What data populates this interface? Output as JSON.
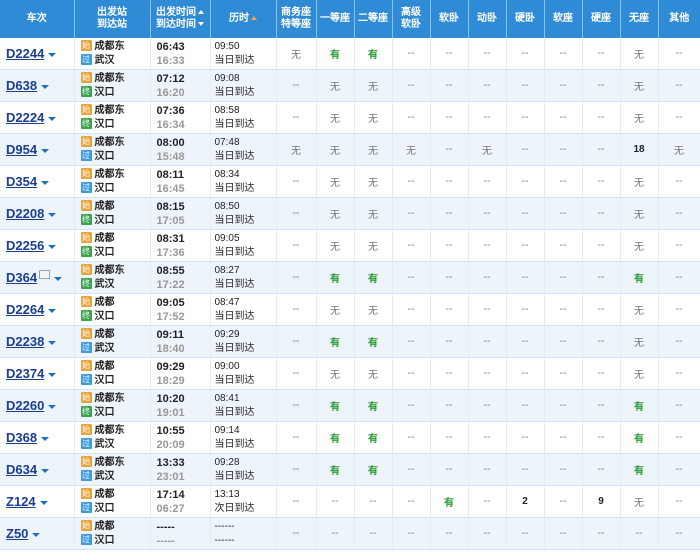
{
  "headers": {
    "train": "车次",
    "station_top": "出发站",
    "station_bottom": "到达站",
    "time_top": "出发时间",
    "time_bottom": "到达时间",
    "duration": "历时",
    "business_top": "商务座",
    "business_bottom": "特等座",
    "first": "一等座",
    "second": "二等座",
    "adv_top": "高级",
    "adv_bottom": "软卧",
    "soft_sleeper": "软卧",
    "moving_sleeper": "动卧",
    "hard_sleeper": "硬卧",
    "soft_seat": "软座",
    "hard_seat": "硬座",
    "no_seat": "无座",
    "other": "其他"
  },
  "station_badges": {
    "start": "始",
    "pass": "过",
    "end": "终"
  },
  "rows": [
    {
      "train": "D2244",
      "id_icon": false,
      "from": "成都东",
      "from_type": "start",
      "to": "武汉",
      "to_type": "pass",
      "dep": "06:43",
      "arr": "16:33",
      "dur": "09:50",
      "day": "当日到达",
      "seats": [
        "无",
        "有",
        "有",
        "--",
        "--",
        "--",
        "--",
        "--",
        "--",
        "无",
        "--"
      ]
    },
    {
      "train": "D638",
      "id_icon": false,
      "from": "成都东",
      "from_type": "start",
      "to": "汉口",
      "to_type": "end",
      "dep": "07:12",
      "arr": "16:20",
      "dur": "09:08",
      "day": "当日到达",
      "seats": [
        "--",
        "无",
        "无",
        "--",
        "--",
        "--",
        "--",
        "--",
        "--",
        "无",
        "--"
      ]
    },
    {
      "train": "D2224",
      "id_icon": false,
      "from": "成都东",
      "from_type": "start",
      "to": "汉口",
      "to_type": "end",
      "dep": "07:36",
      "arr": "16:34",
      "dur": "08:58",
      "day": "当日到达",
      "seats": [
        "--",
        "无",
        "无",
        "--",
        "--",
        "--",
        "--",
        "--",
        "--",
        "无",
        "--"
      ]
    },
    {
      "train": "D954",
      "id_icon": false,
      "from": "成都东",
      "from_type": "start",
      "to": "汉口",
      "to_type": "pass",
      "dep": "08:00",
      "arr": "15:48",
      "dur": "07:48",
      "day": "当日到达",
      "seats": [
        "无",
        "无",
        "无",
        "无",
        "--",
        "无",
        "--",
        "--",
        "--",
        "18",
        "无"
      ]
    },
    {
      "train": "D354",
      "id_icon": false,
      "from": "成都东",
      "from_type": "start",
      "to": "汉口",
      "to_type": "pass",
      "dep": "08:11",
      "arr": "16:45",
      "dur": "08:34",
      "day": "当日到达",
      "seats": [
        "--",
        "无",
        "无",
        "--",
        "--",
        "--",
        "--",
        "--",
        "--",
        "无",
        "--"
      ]
    },
    {
      "train": "D2208",
      "id_icon": false,
      "from": "成都",
      "from_type": "start",
      "to": "汉口",
      "to_type": "end",
      "dep": "08:15",
      "arr": "17:05",
      "dur": "08:50",
      "day": "当日到达",
      "seats": [
        "--",
        "无",
        "无",
        "--",
        "--",
        "--",
        "--",
        "--",
        "--",
        "无",
        "--"
      ]
    },
    {
      "train": "D2256",
      "id_icon": false,
      "from": "成都",
      "from_type": "start",
      "to": "汉口",
      "to_type": "end",
      "dep": "08:31",
      "arr": "17:36",
      "dur": "09:05",
      "day": "当日到达",
      "seats": [
        "--",
        "无",
        "无",
        "--",
        "--",
        "--",
        "--",
        "--",
        "--",
        "无",
        "--"
      ]
    },
    {
      "train": "D364",
      "id_icon": true,
      "from": "成都东",
      "from_type": "start",
      "to": "武汉",
      "to_type": "end",
      "dep": "08:55",
      "arr": "17:22",
      "dur": "08:27",
      "day": "当日到达",
      "seats": [
        "--",
        "有",
        "有",
        "--",
        "--",
        "--",
        "--",
        "--",
        "--",
        "有",
        "--"
      ]
    },
    {
      "train": "D2264",
      "id_icon": false,
      "from": "成都",
      "from_type": "start",
      "to": "汉口",
      "to_type": "end",
      "dep": "09:05",
      "arr": "17:52",
      "dur": "08:47",
      "day": "当日到达",
      "seats": [
        "--",
        "无",
        "无",
        "--",
        "--",
        "--",
        "--",
        "--",
        "--",
        "无",
        "--"
      ]
    },
    {
      "train": "D2238",
      "id_icon": false,
      "from": "成都",
      "from_type": "start",
      "to": "武汉",
      "to_type": "pass",
      "dep": "09:11",
      "arr": "18:40",
      "dur": "09:29",
      "day": "当日到达",
      "seats": [
        "--",
        "有",
        "有",
        "--",
        "--",
        "--",
        "--",
        "--",
        "--",
        "无",
        "--"
      ]
    },
    {
      "train": "D2374",
      "id_icon": false,
      "from": "成都",
      "from_type": "start",
      "to": "汉口",
      "to_type": "pass",
      "dep": "09:29",
      "arr": "18:29",
      "dur": "09:00",
      "day": "当日到达",
      "seats": [
        "--",
        "无",
        "无",
        "--",
        "--",
        "--",
        "--",
        "--",
        "--",
        "无",
        "--"
      ]
    },
    {
      "train": "D2260",
      "id_icon": false,
      "from": "成都东",
      "from_type": "start",
      "to": "汉口",
      "to_type": "end",
      "dep": "10:20",
      "arr": "19:01",
      "dur": "08:41",
      "day": "当日到达",
      "seats": [
        "--",
        "有",
        "有",
        "--",
        "--",
        "--",
        "--",
        "--",
        "--",
        "有",
        "--"
      ]
    },
    {
      "train": "D368",
      "id_icon": false,
      "from": "成都东",
      "from_type": "start",
      "to": "武汉",
      "to_type": "pass",
      "dep": "10:55",
      "arr": "20:09",
      "dur": "09:14",
      "day": "当日到达",
      "seats": [
        "--",
        "有",
        "有",
        "--",
        "--",
        "--",
        "--",
        "--",
        "--",
        "有",
        "--"
      ]
    },
    {
      "train": "D634",
      "id_icon": false,
      "from": "成都东",
      "from_type": "start",
      "to": "武汉",
      "to_type": "pass",
      "dep": "13:33",
      "arr": "23:01",
      "dur": "09:28",
      "day": "当日到达",
      "seats": [
        "--",
        "有",
        "有",
        "--",
        "--",
        "--",
        "--",
        "--",
        "--",
        "有",
        "--"
      ]
    },
    {
      "train": "Z124",
      "id_icon": false,
      "from": "成都",
      "from_type": "start",
      "to": "汉口",
      "to_type": "pass",
      "dep": "17:14",
      "arr": "06:27",
      "dur": "13:13",
      "day": "次日到达",
      "seats": [
        "--",
        "--",
        "--",
        "--",
        "有",
        "--",
        "2",
        "--",
        "9",
        "无",
        "--"
      ]
    },
    {
      "train": "Z50",
      "id_icon": false,
      "from": "成都",
      "from_type": "start",
      "to": "汉口",
      "to_type": "pass",
      "dep": "-----",
      "arr": "-----",
      "dur": "------",
      "day": "------",
      "seats": [
        "--",
        "--",
        "--",
        "--",
        "--",
        "--",
        "--",
        "--",
        "--",
        "--",
        "--"
      ]
    }
  ]
}
